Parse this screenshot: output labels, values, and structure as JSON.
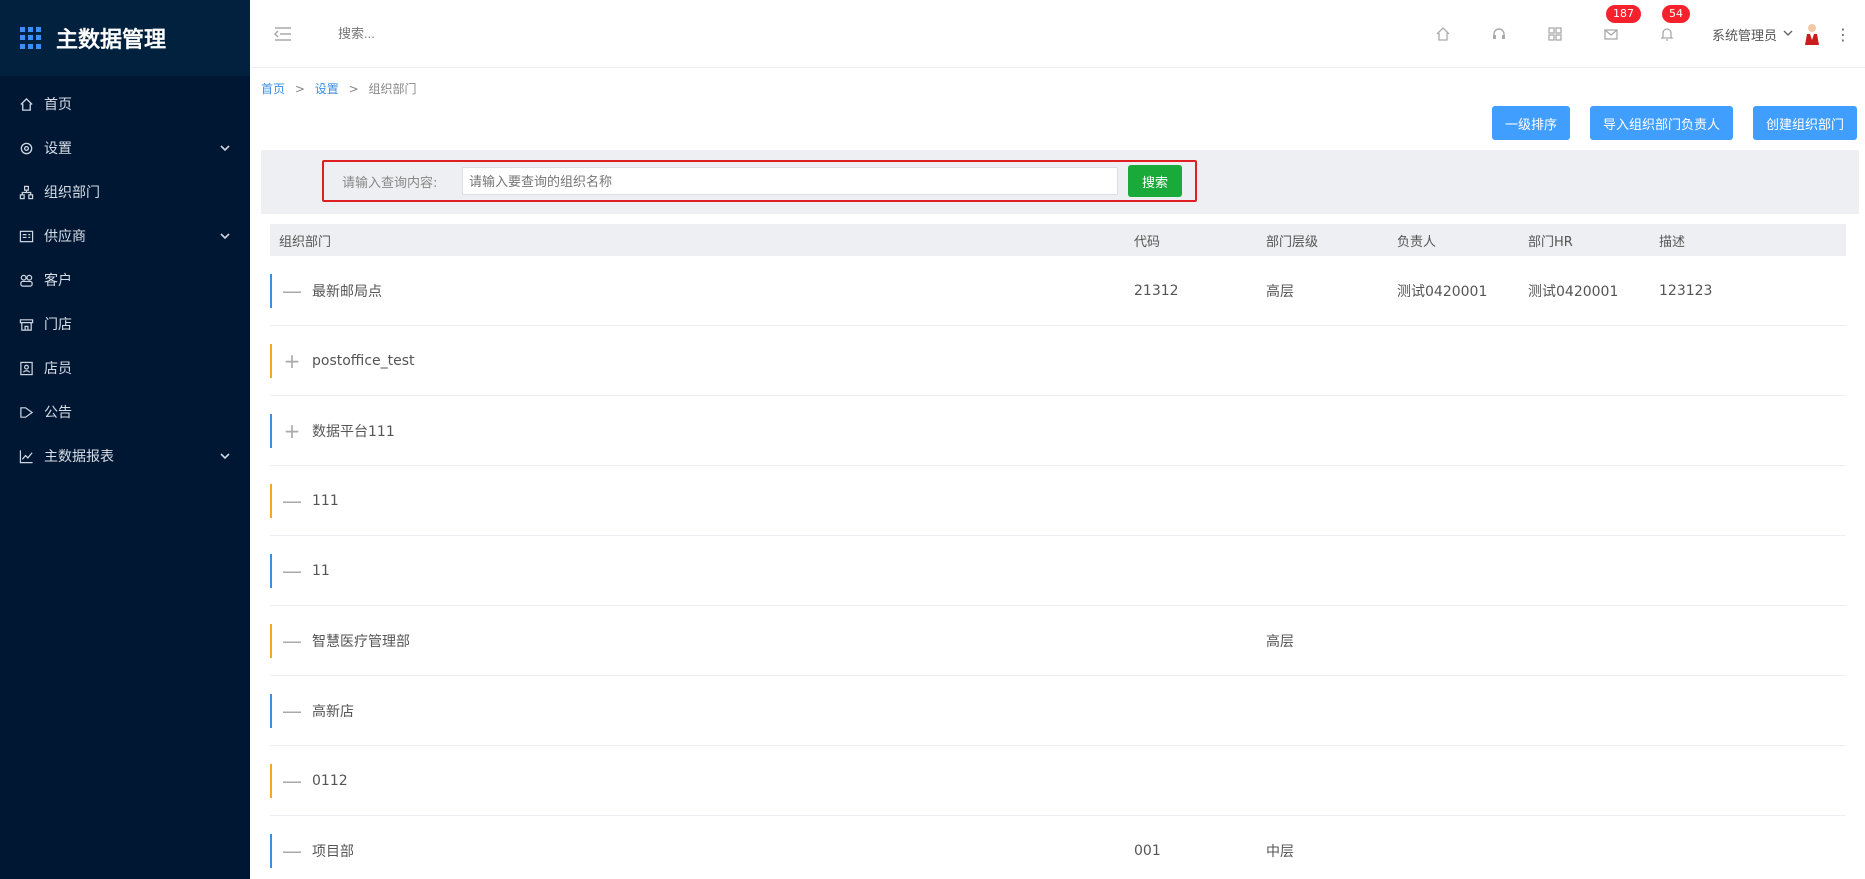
{
  "app": {
    "title": "主数据管理"
  },
  "sidebar": {
    "items": [
      {
        "label": "首页",
        "icon": "home-icon",
        "has_children": false
      },
      {
        "label": "设置",
        "icon": "gear-icon",
        "has_children": true
      },
      {
        "label": "组织部门",
        "icon": "org-icon",
        "has_children": false
      },
      {
        "label": "供应商",
        "icon": "supplier-icon",
        "has_children": true
      },
      {
        "label": "客户",
        "icon": "customer-icon",
        "has_children": false
      },
      {
        "label": "门店",
        "icon": "store-icon",
        "has_children": false
      },
      {
        "label": "店员",
        "icon": "clerk-icon",
        "has_children": false
      },
      {
        "label": "公告",
        "icon": "announcement-icon",
        "has_children": false
      },
      {
        "label": "主数据报表",
        "icon": "chart-icon",
        "has_children": true
      }
    ]
  },
  "topbar": {
    "search_placeholder": "搜索...",
    "mail_badge": "187",
    "bell_badge": "54",
    "user_name": "系统管理员"
  },
  "breadcrumb": {
    "home": "首页",
    "settings": "设置",
    "current": "组织部门",
    "separator": ">"
  },
  "actions": {
    "sort_label": "一级排序",
    "import_label": "导入组织部门负责人",
    "create_label": "创建组织部门"
  },
  "search": {
    "label": "请输入查询内容:",
    "placeholder": "请输入要查询的组织名称",
    "button": "搜索"
  },
  "table": {
    "headers": {
      "name": "组织部门",
      "code": "代码",
      "level": "部门层级",
      "owner": "负责人",
      "hr": "部门HR",
      "desc": "描述"
    },
    "rows": [
      {
        "toggle": "—",
        "bar": "blue",
        "name": "最新邮局点",
        "code": "21312",
        "level": "高层",
        "owner": "测试0420001",
        "hr": "测试0420001",
        "desc": "123123"
      },
      {
        "toggle": "+",
        "bar": "orange",
        "name": "postoffice_test",
        "code": "",
        "level": "",
        "owner": "",
        "hr": "",
        "desc": ""
      },
      {
        "toggle": "+",
        "bar": "blue",
        "name": "数据平台111",
        "code": "",
        "level": "",
        "owner": "",
        "hr": "",
        "desc": ""
      },
      {
        "toggle": "—",
        "bar": "orange",
        "name": "111",
        "code": "",
        "level": "",
        "owner": "",
        "hr": "",
        "desc": ""
      },
      {
        "toggle": "—",
        "bar": "blue",
        "name": "11",
        "code": "",
        "level": "",
        "owner": "",
        "hr": "",
        "desc": ""
      },
      {
        "toggle": "—",
        "bar": "orange",
        "name": "智慧医疗管理部",
        "code": "",
        "level": "高层",
        "owner": "",
        "hr": "",
        "desc": ""
      },
      {
        "toggle": "—",
        "bar": "blue",
        "name": "高新店",
        "code": "",
        "level": "",
        "owner": "",
        "hr": "",
        "desc": ""
      },
      {
        "toggle": "—",
        "bar": "orange",
        "name": "0112",
        "code": "",
        "level": "",
        "owner": "",
        "hr": "",
        "desc": ""
      },
      {
        "toggle": "—",
        "bar": "blue",
        "name": "项目部",
        "code": "001",
        "level": "中层",
        "owner": "",
        "hr": "",
        "desc": ""
      }
    ]
  },
  "colors": {
    "sidebar_bg": "#001733",
    "primary": "#409eff",
    "search_button": "#1aaa3a",
    "highlight_border": "#e02020",
    "badge": "#f5222d"
  }
}
